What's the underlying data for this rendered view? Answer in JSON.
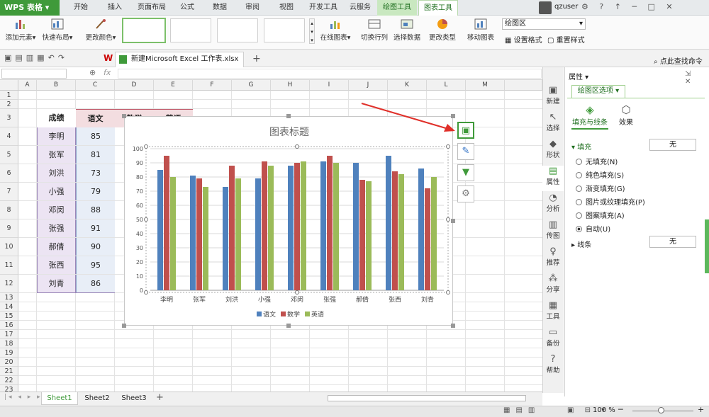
{
  "app": {
    "name": "WPS 表格",
    "user": "qzuser"
  },
  "tabs": [
    "开始",
    "插入",
    "页面布局",
    "公式",
    "数据",
    "审阅",
    "视图",
    "开发工具",
    "云服务",
    "绘图工具",
    "图表工具"
  ],
  "ribbon": {
    "add_element": "添加元素",
    "quick_layout": "快速布局",
    "change_color": "更改颜色",
    "online_chart": "在线图表",
    "switch_rowcol": "切换行列",
    "select_data": "选择数据",
    "change_type": "更改类型",
    "move_chart": "移动图表",
    "area_select": "绘图区",
    "set_format": "设置格式",
    "reset_style": "重置样式"
  },
  "doc_tab": "新建Microsoft Excel 工作表.xlsx *",
  "search": "点此查找命令",
  "columns": [
    "A",
    "B",
    "C",
    "D",
    "E",
    "F",
    "G",
    "H",
    "I",
    "J",
    "K",
    "L",
    "M"
  ],
  "rows": [
    "1",
    "2",
    "3",
    "4",
    "5",
    "6",
    "7",
    "8",
    "9",
    "10",
    "11",
    "12",
    "13",
    "14",
    "15",
    "16",
    "17",
    "18",
    "19",
    "20",
    "21",
    "22",
    "23"
  ],
  "table": {
    "headers": [
      "成绩",
      "语文",
      "数学",
      "英语"
    ],
    "names": [
      "李明",
      "张军",
      "刘洪",
      "小强",
      "邓闵",
      "张强",
      "郝倩",
      "张西",
      "刘青"
    ],
    "chinese": [
      "85",
      "81",
      "73",
      "79",
      "88",
      "91",
      "90",
      "95",
      "86"
    ]
  },
  "chart_data": {
    "type": "bar",
    "title": "图表标题",
    "categories": [
      "李明",
      "张军",
      "刘洪",
      "小强",
      "邓闵",
      "张强",
      "郝倩",
      "张西",
      "刘青"
    ],
    "series": [
      {
        "name": "语文",
        "values": [
          85,
          81,
          73,
          79,
          88,
          91,
          90,
          95,
          86
        ],
        "color": "#4f81bd"
      },
      {
        "name": "数学",
        "values": [
          95,
          79,
          88,
          91,
          90,
          95,
          78,
          84,
          72
        ],
        "color": "#c0504d"
      },
      {
        "name": "英语",
        "values": [
          80,
          73,
          79,
          88,
          91,
          90,
          77,
          82,
          80
        ],
        "color": "#9bbb59"
      }
    ],
    "ylim": [
      0,
      100
    ],
    "yticks": [
      "0",
      "10",
      "20",
      "30",
      "40",
      "50",
      "60",
      "70",
      "80",
      "90",
      "100"
    ],
    "legend": "bottom",
    "grid": true
  },
  "sidebar": [
    "新建",
    "选择",
    "形状",
    "属性",
    "分析",
    "传图",
    "推荐",
    "分享",
    "工具",
    "备份",
    "帮助"
  ],
  "panel": {
    "title": "属性",
    "dropdown": "绘图区选项",
    "tab_fill": "填充与线条",
    "tab_effect": "效果",
    "fill_label": "填充",
    "fill_value": "无",
    "options": [
      "无填充(N)",
      "纯色填充(S)",
      "渐变填充(G)",
      "图片或纹理填充(P)",
      "图案填充(A)",
      "自动(U)"
    ],
    "line_label": "线条",
    "line_value": "无"
  },
  "sheets": [
    "Sheet1",
    "Sheet2",
    "Sheet3"
  ],
  "zoom": "100 %"
}
